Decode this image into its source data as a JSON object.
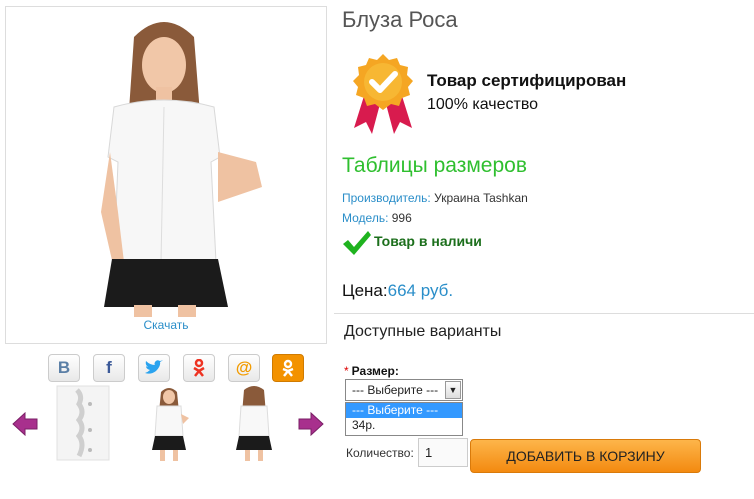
{
  "product": {
    "title": "Блуза Роса",
    "download_label": "Скачать",
    "certificate": {
      "title": "Товар сертифицирован",
      "subtitle": "100% качество"
    },
    "size_table_link": "Таблицы размеров",
    "manufacturer_key": "Производитель:",
    "manufacturer_value": "Украина Tashkan",
    "model_key": "Модель:",
    "model_value": "996",
    "stock_status": "Товар в наличи",
    "price_key": "Цена:",
    "price_value": "664 руб."
  },
  "share": {
    "icons": [
      "vkontakte-icon",
      "facebook-icon",
      "twitter-icon",
      "odnoklassniki-icon",
      "mailru-icon",
      "ok-icon"
    ],
    "labels": [
      "B",
      "f",
      "",
      "",
      "@",
      ""
    ]
  },
  "options": {
    "heading": "Доступные варианты",
    "required_mark": "*",
    "size_label": "Размер:",
    "size_selected": "--- Выберите ---",
    "size_options": [
      "--- Выберите ---",
      "34р."
    ]
  },
  "cart": {
    "quantity_label": "Количество:",
    "quantity_value": "1",
    "add_button": "ДОБАВИТЬ В КОРЗИНУ"
  },
  "colors": {
    "accent_blue": "#2a8ec9",
    "green": "#2fbf2f",
    "orange": "#f38a10"
  }
}
